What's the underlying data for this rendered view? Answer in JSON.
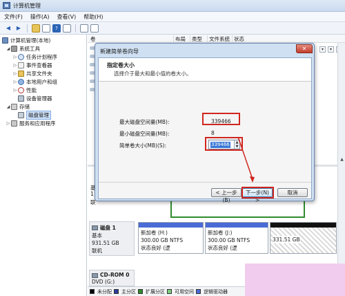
{
  "window": {
    "title": "计算机管理"
  },
  "menu": [
    "文件(F)",
    "操作(A)",
    "查看(V)",
    "帮助(H)"
  ],
  "tree": {
    "root": "计算机管理(本地)",
    "system_tools": "系统工具",
    "task_scheduler": "任务计划程序",
    "event_viewer": "事件查看器",
    "shared_folders": "共享文件夹",
    "local_users": "本地用户和组",
    "performance": "性能",
    "device_manager": "设备管理器",
    "storage": "存储",
    "disk_management": "磁盘管理",
    "services": "服务和应用程序"
  },
  "columns": {
    "c1": "卷",
    "c2": "布局",
    "c3": "类型",
    "c4": "文件系统",
    "c5": "状态"
  },
  "wizard": {
    "title": "新建简单卷向导",
    "heading": "指定卷大小",
    "subheading": "选择介于最大和最小值的卷大小。",
    "max_label": "最大磁盘空间量(MB):",
    "max_value": "339466",
    "min_label": "最小磁盘空间量(MB):",
    "min_value": "8",
    "size_label": "简单卷大小(MB)(S):",
    "size_value": "339466",
    "back": "< 上一步(B)",
    "next": "下一步(N) >",
    "cancel": "取消"
  },
  "disk1": {
    "name": "磁盘 1",
    "type": "基本",
    "size": "931.51 GB",
    "status": "联机",
    "partitions": [
      {
        "name": "新加卷 (H:)",
        "size": "300.00 GB NTFS",
        "status": "状态良好 (逻"
      },
      {
        "name": "新加卷 (J:)",
        "size": "300.00 GB NTFS",
        "status": "状态良好 (逻"
      },
      {
        "size": "331.51 GB"
      }
    ]
  },
  "cdrom": {
    "name": "CD-ROM 0",
    "type": "DVD (G:)"
  },
  "legend": [
    "未分配",
    "主分区",
    "扩展分区",
    "可用空间",
    "逻辑驱动器"
  ],
  "colors": {
    "unallocated": "#000000",
    "primary": "#2a3c9e",
    "extended": "#2e8b2e",
    "free": "#7fd07f",
    "logical": "#4a6ad6",
    "annotation": "#d0261e"
  },
  "partial_texts": {
    "left_fragment_1": "基",
    "left_fragment_2": "1",
    "left_fragment_3": "联"
  }
}
